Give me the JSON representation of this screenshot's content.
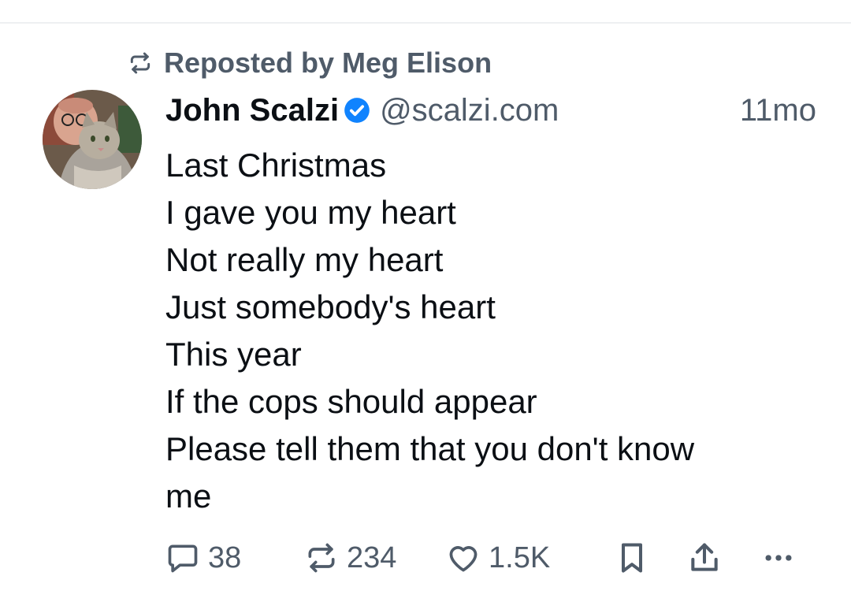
{
  "repost": {
    "label": "Reposted by Meg Elison",
    "icon": "repost-icon"
  },
  "author": {
    "name": "John Scalzi",
    "handle": "@scalzi.com",
    "verified_icon": "verified-check-icon",
    "avatar": "avatar-man-with-cat"
  },
  "post": {
    "time": "11mo",
    "lines": [
      "Last Christmas",
      "I gave you my heart",
      "Not really my heart",
      "Just somebody's heart",
      "This year",
      "If the cops should appear",
      "Please tell them that you don't know",
      "me"
    ]
  },
  "actions": {
    "replies": "38",
    "reposts": "234",
    "likes": "1.5K",
    "icons": [
      "reply-icon",
      "repost-icon",
      "heart-icon",
      "bookmark-icon",
      "share-icon",
      "more-icon"
    ]
  },
  "colors": {
    "text": "#0b0f14",
    "muted": "#4f5b69",
    "verified": "#1083fe"
  }
}
